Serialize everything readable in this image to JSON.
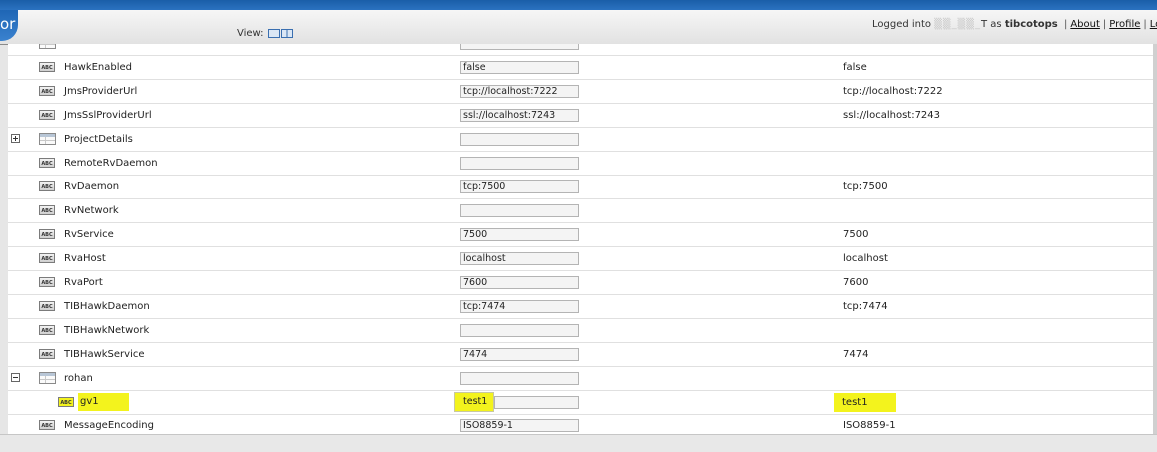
{
  "header": {
    "title_fragment": "or",
    "view_label": "View:",
    "logged_prefix": "Logged into",
    "masked_machine": "T",
    "as_word": "as",
    "username": "tibcotops",
    "links": [
      "About",
      "Profile",
      "Lo"
    ]
  },
  "rows": [
    {
      "name": "",
      "value": "",
      "deployed": "",
      "icon": "table",
      "expander": "none",
      "partial": true
    },
    {
      "name": "HawkEnabled",
      "value": "false",
      "deployed": "false",
      "icon": "abc",
      "expander": "none"
    },
    {
      "name": "JmsProviderUrl",
      "value": "tcp://localhost:7222",
      "deployed": "tcp://localhost:7222",
      "icon": "abc",
      "expander": "none"
    },
    {
      "name": "JmsSslProviderUrl",
      "value": "ssl://localhost:7243",
      "deployed": "ssl://localhost:7243",
      "icon": "abc",
      "expander": "none"
    },
    {
      "name": "ProjectDetails",
      "value": "",
      "deployed": "",
      "icon": "table",
      "expander": "plus"
    },
    {
      "name": "RemoteRvDaemon",
      "value": "",
      "deployed": "",
      "icon": "abc",
      "expander": "none"
    },
    {
      "name": "RvDaemon",
      "value": "tcp:7500",
      "deployed": "tcp:7500",
      "icon": "abc",
      "expander": "none"
    },
    {
      "name": "RvNetwork",
      "value": "",
      "deployed": "",
      "icon": "abc",
      "expander": "none"
    },
    {
      "name": "RvService",
      "value": "7500",
      "deployed": "7500",
      "icon": "abc",
      "expander": "none"
    },
    {
      "name": "RvaHost",
      "value": "localhost",
      "deployed": "localhost",
      "icon": "abc",
      "expander": "none"
    },
    {
      "name": "RvaPort",
      "value": "7600",
      "deployed": "7600",
      "icon": "abc",
      "expander": "none"
    },
    {
      "name": "TIBHawkDaemon",
      "value": "tcp:7474",
      "deployed": "tcp:7474",
      "icon": "abc",
      "expander": "none"
    },
    {
      "name": "TIBHawkNetwork",
      "value": "",
      "deployed": "",
      "icon": "abc",
      "expander": "none"
    },
    {
      "name": "TIBHawkService",
      "value": "7474",
      "deployed": "7474",
      "icon": "abc",
      "expander": "none"
    },
    {
      "name": "rohan",
      "value": "",
      "deployed": "",
      "icon": "table",
      "expander": "minus"
    },
    {
      "name": "gv1",
      "value": "test1",
      "deployed": "test1",
      "icon": "abc",
      "expander": "none",
      "child": true,
      "highlight": true
    },
    {
      "name": "MessageEncoding",
      "value": "ISO8859-1",
      "deployed": "ISO8859-1",
      "icon": "abc",
      "expander": "none"
    }
  ],
  "icon_text": "ABC",
  "colors": {
    "highlight": "#f3f31d",
    "header_blue": "#2b72c0"
  }
}
